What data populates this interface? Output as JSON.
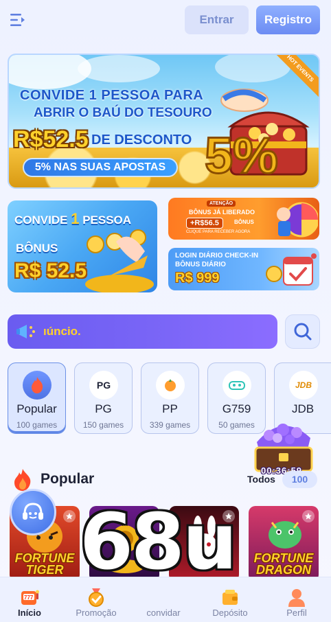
{
  "header": {
    "login_label": "Entrar",
    "register_label": "Registro"
  },
  "hero": {
    "line1": "CONVIDE 1 PESSOA PARA",
    "line2": "ABRIR O BAÚ DO TESOURO",
    "amount": "R$52.5",
    "discount": "DE DESCONTO",
    "pill": "5% NAS SUAS APOSTAS",
    "ribbon": "HOT EVENTS",
    "percent": "5%"
  },
  "tile_invite": {
    "line1_a": "CONVIDE",
    "line1_num": "1",
    "line1_b": "PESSOA",
    "line2": "BÔNUS",
    "amount": "R$ 52.5"
  },
  "tile_bonus": {
    "atencao": "ATENÇÃO",
    "title": "BÔNUS JÁ LIBERADO",
    "amount": "+R$56.5",
    "amount_suffix": "BÔNUS",
    "cta": "CLIQUE PARA RECEBER AGORA"
  },
  "tile_checkin": {
    "line1": "LOGIN DIÁRIO CHECK-IN",
    "line2": "BÔNUS DIÁRIO",
    "amount": "R$ 999"
  },
  "marquee": {
    "text": "ıúncio."
  },
  "categories": [
    {
      "name": "Popular",
      "count": "100 games",
      "icon": "flame-icon"
    },
    {
      "name": "PG",
      "count": "150 games",
      "icon": "PG"
    },
    {
      "name": "PP",
      "count": "339 games",
      "icon": "pp-icon"
    },
    {
      "name": "G759",
      "count": "50 games",
      "icon": "gamepad-icon"
    },
    {
      "name": "JDB",
      "count": "",
      "icon": "JDB"
    }
  ],
  "popular": {
    "title": "Popular",
    "todos_label": "Todos",
    "todos_count": "100",
    "timer": "00:36:59"
  },
  "games": [
    {
      "name": "FORTUNE TIGER"
    },
    {
      "name": ""
    },
    {
      "name": ""
    },
    {
      "name": "FORTUNE DRAGON"
    }
  ],
  "watermark": "68u",
  "nav": [
    {
      "label": "Início",
      "icon": "slot-machine-icon",
      "active": true
    },
    {
      "label": "Promoção",
      "icon": "medal-icon",
      "active": false
    },
    {
      "label": "convidar",
      "icon": "invite-icon",
      "active": false
    },
    {
      "label": "Depósito",
      "icon": "wallet-icon",
      "active": false
    },
    {
      "label": "Perfil",
      "icon": "person-icon",
      "active": false
    }
  ],
  "colors": {
    "accent": "#6c8cf3",
    "marquee": "#7b66f7",
    "gold": "#ffd12b",
    "background": "#eef2ff"
  }
}
